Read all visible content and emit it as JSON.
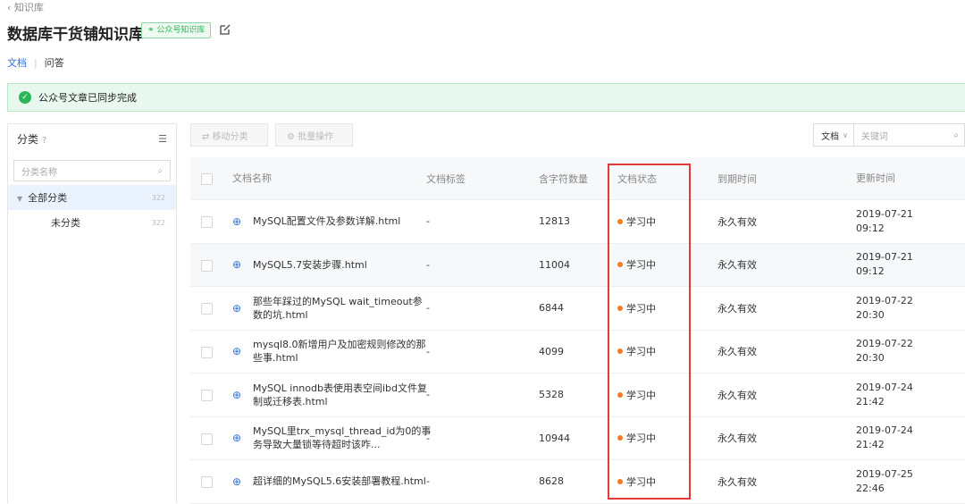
{
  "breadcrumb": "‹ 知识库",
  "title": "数据库干货铺知识库",
  "badge": "公众号知识库",
  "tabs": {
    "docs": "文档",
    "qa": "问答"
  },
  "alert": "公众号文章已同步完成",
  "sidebar": {
    "heading": "分类",
    "search_placeholder": "分类名称",
    "categories": [
      {
        "label": "全部分类",
        "count": "322"
      },
      {
        "label": "未分类",
        "count": "322"
      }
    ]
  },
  "toolbar": {
    "move": "⇄ 移动分类",
    "batch": "⚙ 批量操作"
  },
  "filter": {
    "type": "文档",
    "placeholder": "关键词"
  },
  "table": {
    "headers": [
      "文档名称",
      "文档标签",
      "含字符数量",
      "文档状态",
      "到期时间",
      "更新时间"
    ],
    "rows": [
      {
        "name": "MySQL配置文件及参数详解.html",
        "tag": "-",
        "chars": "12813",
        "status": "学习中",
        "expire": "永久有效",
        "date": "2019-07-21",
        "time": "09:12"
      },
      {
        "name": "MySQL5.7安装步骤.html",
        "tag": "-",
        "chars": "11004",
        "status": "学习中",
        "expire": "永久有效",
        "date": "2019-07-21",
        "time": "09:12"
      },
      {
        "name": "那些年踩过的MySQL wait_timeout参数的坑.html",
        "tag": "-",
        "chars": "6844",
        "status": "学习中",
        "expire": "永久有效",
        "date": "2019-07-22",
        "time": "20:30"
      },
      {
        "name": "mysql8.0新增用户及加密规则修改的那些事.html",
        "tag": "-",
        "chars": "4099",
        "status": "学习中",
        "expire": "永久有效",
        "date": "2019-07-22",
        "time": "20:30"
      },
      {
        "name": "MySQL innodb表使用表空间ibd文件复制或迁移表.html",
        "tag": "-",
        "chars": "5328",
        "status": "学习中",
        "expire": "永久有效",
        "date": "2019-07-24",
        "time": "21:42"
      },
      {
        "name": "MySQL里trx_mysql_thread_id为0的事务导致大量锁等待超时该咋...",
        "tag": "-",
        "chars": "10944",
        "status": "学习中",
        "expire": "永久有效",
        "date": "2019-07-24",
        "time": "21:42"
      },
      {
        "name": "超详细的MySQL5.6安装部署教程.html",
        "tag": "-",
        "chars": "8628",
        "status": "学习中",
        "expire": "永久有效",
        "date": "2019-07-25",
        "time": "22:46"
      }
    ]
  }
}
